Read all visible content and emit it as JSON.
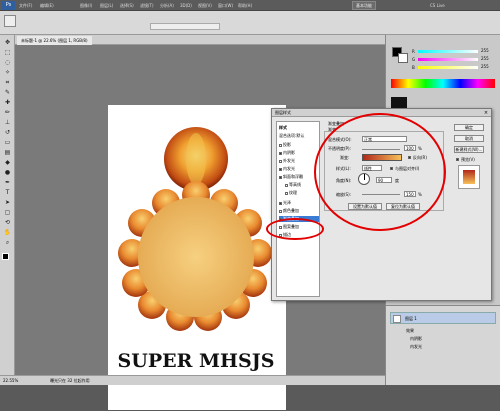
{
  "menubar": {
    "logo": "Ps",
    "items": [
      "文件(F)",
      "编辑(E)",
      "图像(I)",
      "图层(L)",
      "选择(S)",
      "滤镜(T)",
      "分析(A)",
      "3D(D)",
      "视图(V)",
      "窗口(W)",
      "帮助(H)"
    ],
    "workspace_button": "基本功能",
    "cs_live": "CS Live"
  },
  "document": {
    "tab_label": "未标题-1 @ 22.6% (图层 1, RGB/8)",
    "zoom": "22.55%",
    "status": "曝光只在 32 位起作用"
  },
  "canvas": {
    "text": "SUPER MHSJS"
  },
  "dialog": {
    "title": "图层样式",
    "styles_header": "样式",
    "blend_options": "混合选项:默认",
    "style_items": [
      {
        "label": "投影",
        "checked": false
      },
      {
        "label": "内阴影",
        "checked": true
      },
      {
        "label": "外发光",
        "checked": false
      },
      {
        "label": "内发光",
        "checked": true
      },
      {
        "label": "斜面和浮雕",
        "checked": true
      },
      {
        "label": "等高线",
        "checked": false
      },
      {
        "label": "纹理",
        "checked": false
      },
      {
        "label": "光泽",
        "checked": true
      },
      {
        "label": "颜色叠加",
        "checked": false
      },
      {
        "label": "渐变叠加",
        "checked": true,
        "selected": true
      },
      {
        "label": "图案叠加",
        "checked": false
      },
      {
        "label": "描边",
        "checked": false
      }
    ],
    "section_title": "渐变叠加",
    "sub_title": "渐变",
    "blend_mode_label": "混合模式(O):",
    "blend_mode_value": "正常",
    "opacity_label": "不透明度(P):",
    "opacity_value": "100",
    "gradient_label": "渐变:",
    "reverse_label": "反向(R)",
    "style_label": "样式(L):",
    "style_value": "线性",
    "align_label": "与图层对齐(I)",
    "angle_label": "角度(N):",
    "angle_value": "90",
    "degree": "度",
    "scale_label": "缩放(S):",
    "scale_value": "150",
    "percent": "%",
    "default_btn": "设置为默认值",
    "reset_btn": "复位为默认值",
    "ok_btn": "确定",
    "cancel_btn": "取消",
    "new_style_btn": "新建样式(W)...",
    "preview_label": "预览(V)"
  },
  "panels": {
    "r": "255",
    "g": "255",
    "b": "255",
    "layer_name": "图层 1",
    "effects_label": "效果",
    "fx1": "内阴影",
    "fx2": "内发光"
  },
  "colors": {
    "gradient_start": "#b0281a",
    "gradient_end": "#f7c15a",
    "highlight": "#e20000",
    "selection": "#3a7bd5"
  }
}
